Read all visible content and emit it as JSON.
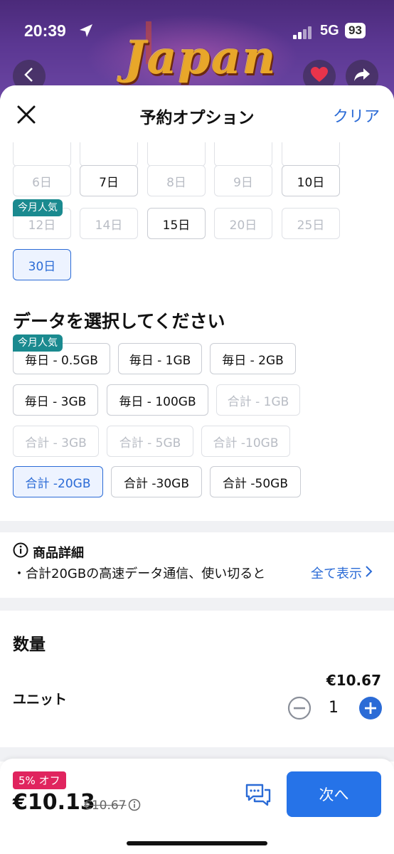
{
  "status_bar": {
    "time": "20:39",
    "network": "5G",
    "battery": "93"
  },
  "hero": {
    "logo_text": "Japan"
  },
  "sheet": {
    "title": "予約オプション",
    "clear_label": "クリア"
  },
  "days": {
    "row0": [
      "",
      "",
      "",
      "",
      ""
    ],
    "row1": [
      "6日",
      "7日",
      "8日",
      "9日",
      "10日"
    ],
    "row2": [
      "12日",
      "14日",
      "15日",
      "20日",
      "25日"
    ],
    "row3": [
      "30日"
    ],
    "popular_badge": "今月人気"
  },
  "data_section": {
    "title": "データを選択してください",
    "popular_badge": "今月人気",
    "options": [
      "毎日 - 0.5GB",
      "毎日 - 1GB",
      "毎日 - 2GB",
      "毎日 - 3GB",
      "毎日 - 100GB",
      "合計 - 1GB",
      "合計 - 3GB",
      "合計 - 5GB",
      "合計 -10GB",
      "合計 -20GB",
      "合計 -30GB",
      "合計 -50GB"
    ],
    "selected": "合計 -20GB"
  },
  "details": {
    "title": "商品詳細",
    "text": "・合計20GBの高速データ通信、使い切ると",
    "show_all": "全て表示"
  },
  "quantity": {
    "title": "数量",
    "unit_label": "ユニット",
    "unit_price": "€10.67",
    "value": "1"
  },
  "bottom_bar": {
    "discount": "5% オフ",
    "price": "€10.13",
    "original_price": "€10.67",
    "next_label": "次へ"
  },
  "colors": {
    "accent": "#2b6bd6",
    "badge": "#1a8a8f",
    "discount": "#e0245e",
    "next_button": "#2673e8"
  }
}
